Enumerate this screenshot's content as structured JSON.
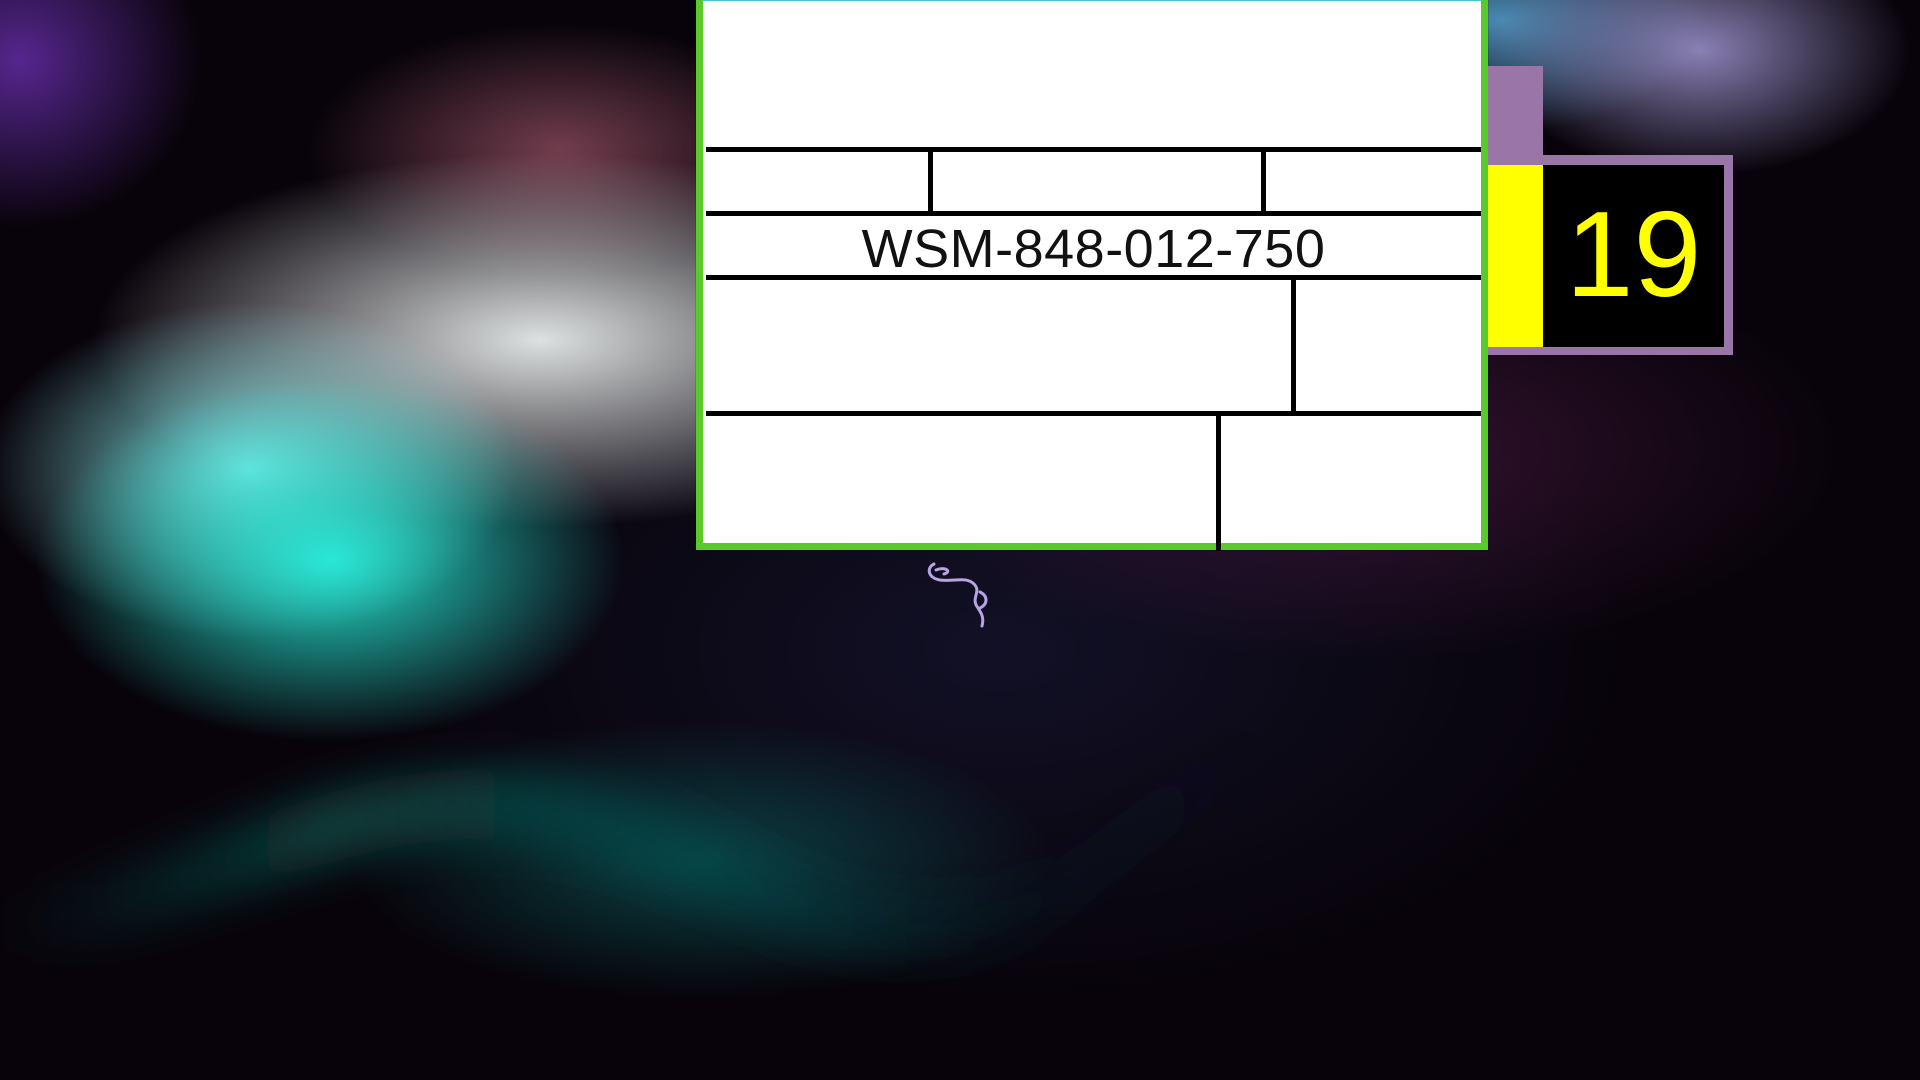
{
  "label": {
    "part_number": "WSM-848-012-750"
  },
  "badge": {
    "count": "19"
  },
  "colors": {
    "window_border": "#5ac92a",
    "badge_frame": "#9a76a8",
    "badge_accent": "#ffff00",
    "badge_background": "#000000"
  },
  "icons": {
    "logo": "snake-logo-icon"
  }
}
